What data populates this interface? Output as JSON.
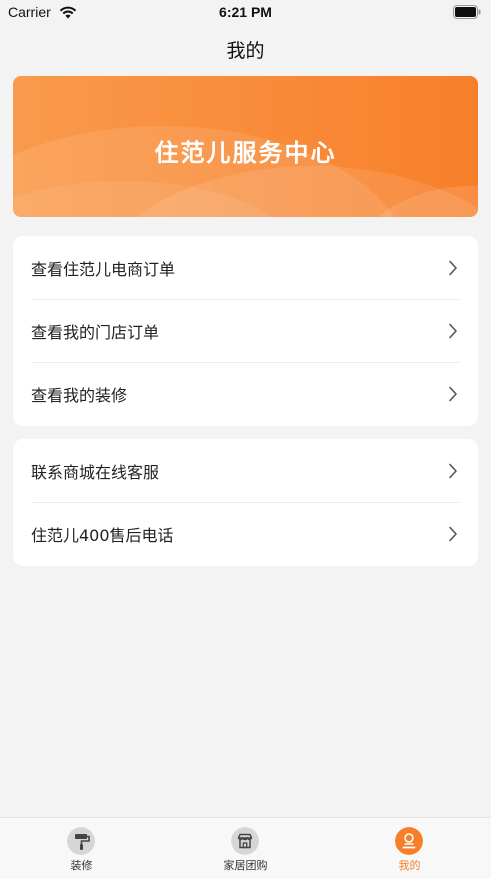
{
  "status_bar": {
    "carrier": "Carrier",
    "time": "6:21 PM"
  },
  "nav": {
    "title": "我的"
  },
  "banner": {
    "title": "住范儿服务中心"
  },
  "menu_group_1": [
    {
      "label": "查看住范儿电商订单"
    },
    {
      "label": "查看我的门店订单"
    },
    {
      "label": "查看我的装修"
    }
  ],
  "menu_group_2": [
    {
      "label": "联系商城在线客服"
    },
    {
      "label": "住范儿400售后电话"
    }
  ],
  "tab_bar": {
    "active_index": 2,
    "tabs": [
      {
        "label": "装修",
        "icon": "paint-roller-icon"
      },
      {
        "label": "家居团购",
        "icon": "store-icon"
      },
      {
        "label": "我的",
        "icon": "profile-icon"
      }
    ]
  },
  "colors": {
    "accent": "#f77f2a",
    "banner_start": "#fa9a4c",
    "background": "#f3f3f3"
  }
}
